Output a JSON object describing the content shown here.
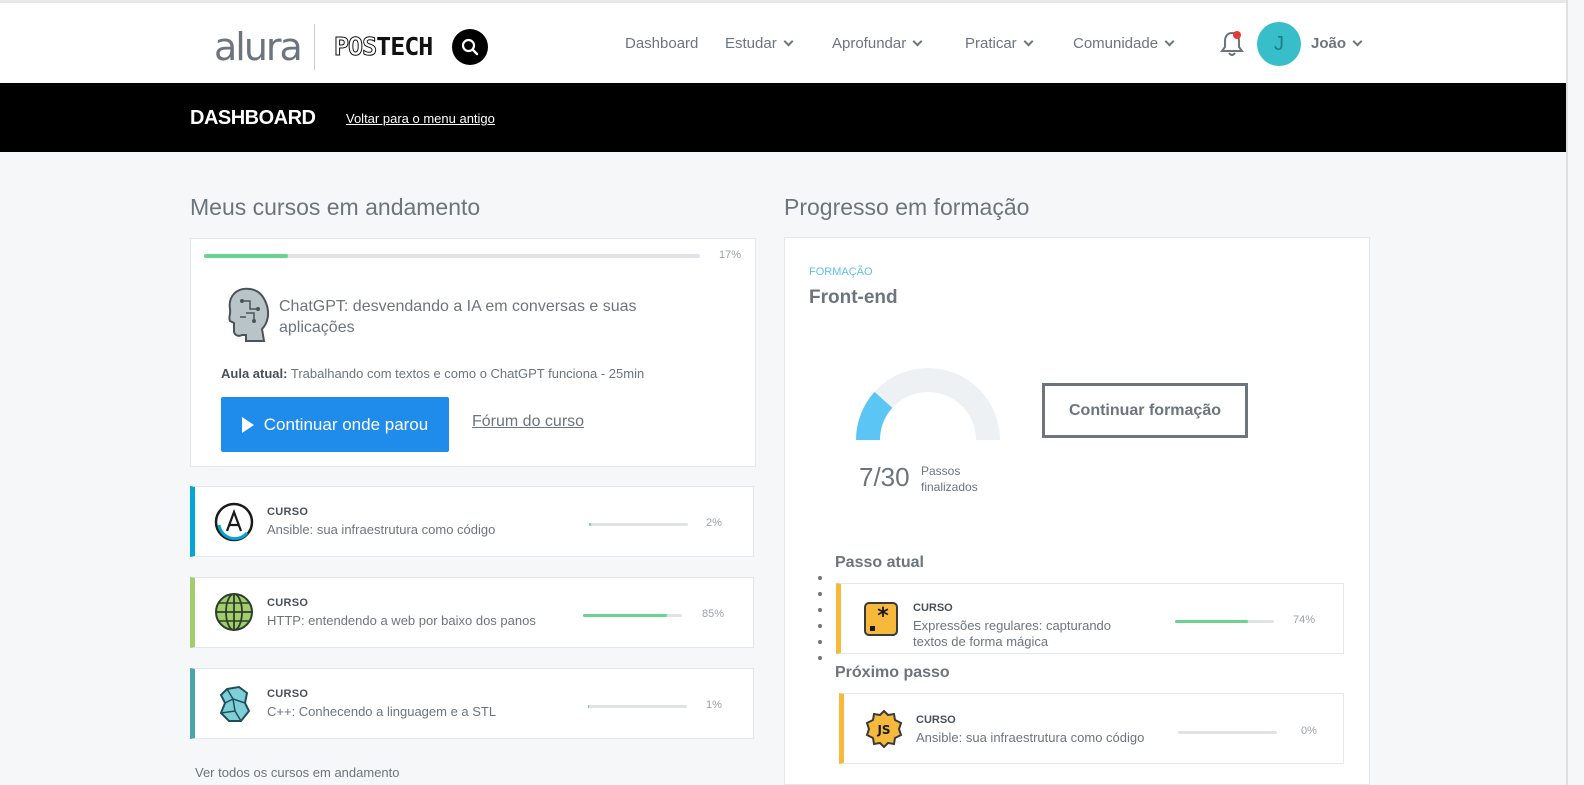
{
  "header": {
    "logo_alura": "alura",
    "logo_postech_pos": "POS",
    "logo_postech_tech": "TECH",
    "nav": [
      {
        "label": "Dashboard"
      },
      {
        "label": "Estudar"
      },
      {
        "label": "Aprofundar"
      },
      {
        "label": "Praticar"
      },
      {
        "label": "Comunidade"
      }
    ],
    "user": {
      "initial": "J",
      "name": "João"
    }
  },
  "subheader": {
    "title": "DASHBOARD",
    "old_menu_link": "Voltar para o menu antigo"
  },
  "courses_section": {
    "title": "Meus cursos em andamento",
    "current": {
      "progress": 17,
      "progress_label": "17%",
      "name": "ChatGPT: desvendando a IA em conversas e suas aplicações",
      "lesson_label": "Aula atual:",
      "lesson": "Trabalhando com textos e como o ChatGPT funciona - 25min",
      "continue_button": "Continuar onde parou",
      "forum_link": "Fórum do curso"
    },
    "others": [
      {
        "tag": "CURSO",
        "name": "Ansible: sua infraestrutura como código",
        "progress": 2,
        "progress_label": "2%",
        "accent": "#00a6d6",
        "icon": "ansible-icon"
      },
      {
        "tag": "CURSO",
        "name": "HTTP: entendendo a web por baixo dos panos",
        "progress": 85,
        "progress_label": "85%",
        "accent": "#a3cd6b",
        "icon": "globe-icon"
      },
      {
        "tag": "CURSO",
        "name": "C++: Conhecendo a linguagem e a STL",
        "progress": 1,
        "progress_label": "1%",
        "accent": "#4aa5a8",
        "icon": "cpp-icon"
      }
    ],
    "see_all": "Ver todos os cursos em andamento"
  },
  "formation_section": {
    "title": "Progresso em formação",
    "tag": "FORMAÇÃO",
    "name": "Front-end",
    "steps_done": "7/30",
    "steps_done_value": 7,
    "steps_total_value": 30,
    "steps_label": "Passos finalizados",
    "continue_button": "Continuar formação",
    "current_step_heading": "Passo atual",
    "current_step": {
      "tag": "CURSO",
      "name": "Expressões regulares: capturando textos de forma mágica",
      "progress": 74,
      "progress_label": "74%"
    },
    "next_step_heading": "Próximo passo",
    "next_step": {
      "tag": "CURSO",
      "name": "Ansible: sua infraestrutura como código",
      "progress": 0,
      "progress_label": "0%"
    }
  },
  "colors": {
    "primary_button": "#1f8ceb",
    "progress_green": "#6ad38e",
    "formation_accent": "#f6b93b",
    "gauge_fill": "#5bc6f5",
    "avatar": "#38bec9"
  }
}
